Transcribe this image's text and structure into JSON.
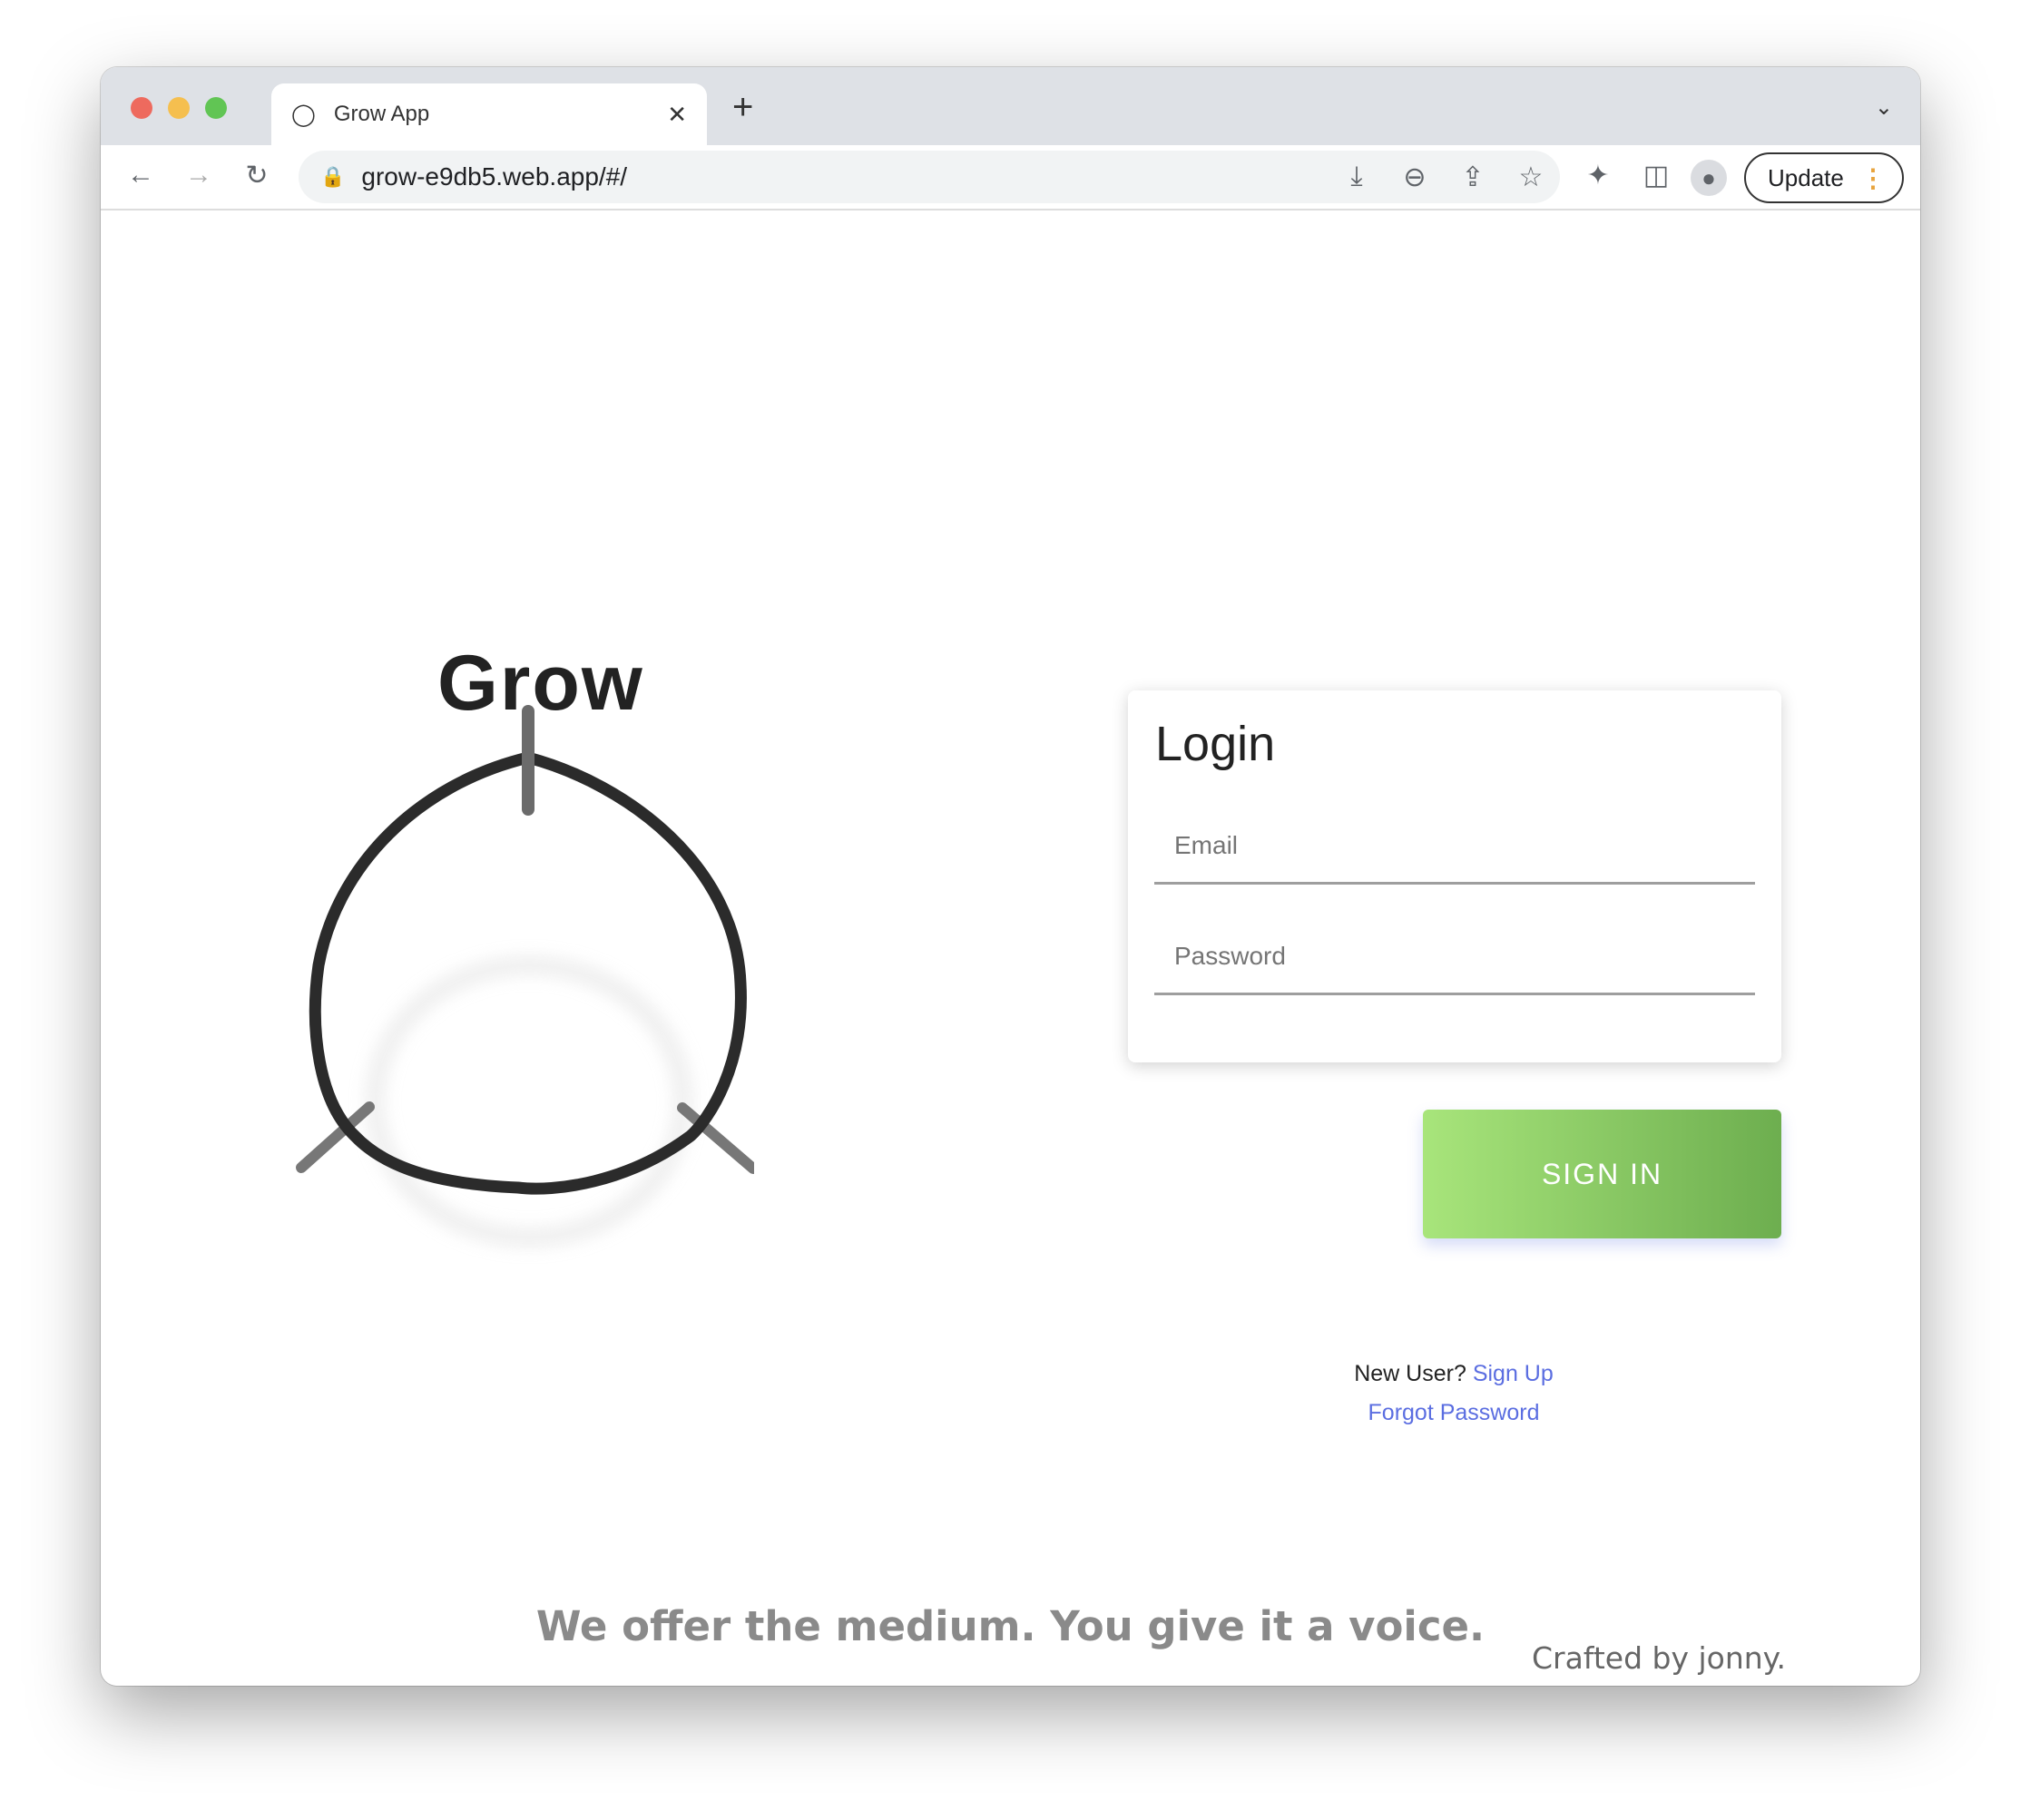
{
  "browser": {
    "tab_title": "Grow App",
    "tab_icon": "grow-logo-icon",
    "url": "grow-e9db5.web.app/#/",
    "update_label": "Update"
  },
  "brand": {
    "title": "Grow"
  },
  "login": {
    "title": "Login",
    "email_placeholder": "Email",
    "password_placeholder": "Password",
    "sign_in_label": "SIGN IN",
    "new_user_text": "New User?",
    "sign_up_link": "Sign Up",
    "forgot_password_link": "Forgot Password"
  },
  "footer": {
    "tagline": "We offer the medium. You give it a voice.",
    "credit": "Crafted by jonny."
  },
  "colors": {
    "accent_link": "#5b6ee1",
    "button_start": "#a6e27a",
    "button_end": "#6cae4f"
  }
}
